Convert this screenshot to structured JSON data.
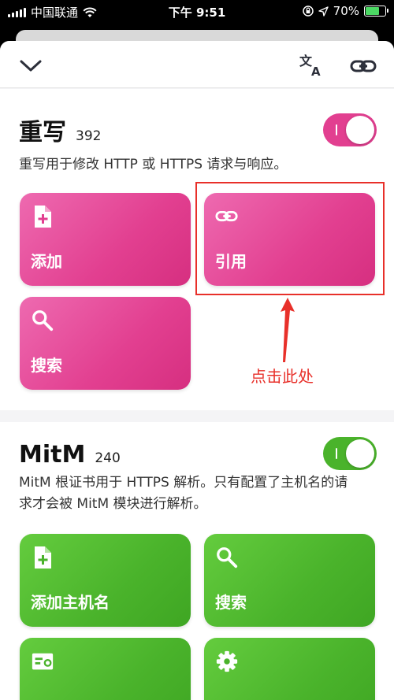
{
  "status_bar": {
    "carrier": "中国联通",
    "time": "下午 9:51",
    "battery": "70%",
    "battery_level": 0.7,
    "icons": [
      "signal-icon",
      "wifi-icon",
      "orientation-lock-icon",
      "location-icon",
      "battery-charging-icon"
    ]
  },
  "toolbar": {
    "icons": [
      "chevron-down-icon",
      "translate-icon",
      "link-icon"
    ]
  },
  "rewrite": {
    "title": "重写",
    "count": "392",
    "description": "重写用于修改 HTTP 或 HTTPS 请求与响应。",
    "enabled": true,
    "accent": "#e23f90",
    "tiles": [
      {
        "label": "添加",
        "icon": "file-add-icon"
      },
      {
        "label": "引用",
        "icon": "link-icon"
      },
      {
        "label": "搜索",
        "icon": "search-icon"
      }
    ]
  },
  "annotation": {
    "text": "点击此处",
    "color": "#e8302a"
  },
  "mitm": {
    "title": "MitM",
    "count": "240",
    "description": "MitM 根证书用于 HTTPS 解析。只有配置了主机名的请求才会被 MitM 模块进行解析。",
    "enabled": true,
    "accent": "#4ab32b",
    "tiles": [
      {
        "label": "添加主机名",
        "icon": "file-add-icon"
      },
      {
        "label": "搜索",
        "icon": "search-icon"
      },
      {
        "label": "",
        "icon": "certificate-icon"
      },
      {
        "label": "",
        "icon": "gear-icon"
      }
    ]
  }
}
